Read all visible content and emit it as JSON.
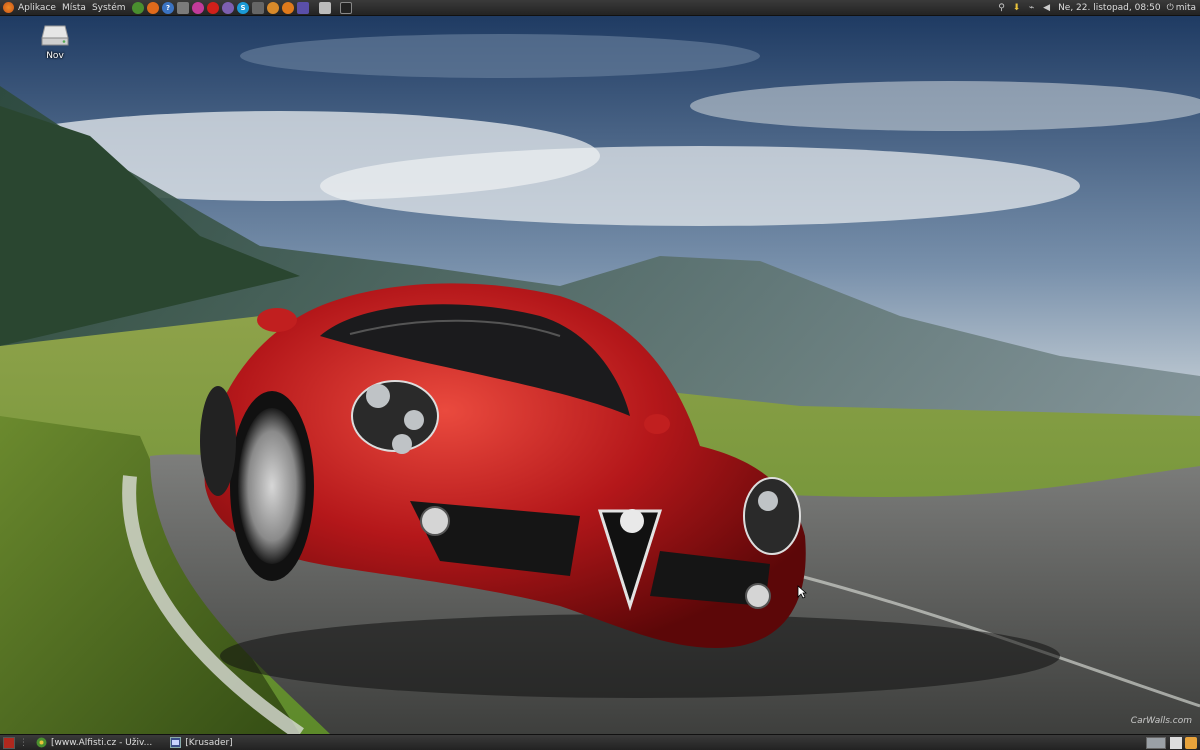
{
  "top_panel": {
    "menus": [
      {
        "label": "Aplikace"
      },
      {
        "label": "Místa"
      },
      {
        "label": "Systém"
      }
    ],
    "launchers": [
      {
        "icon": "chrome-icon",
        "color": "#4a8f2f"
      },
      {
        "icon": "firefox-icon",
        "color": "#e06a1b"
      },
      {
        "icon": "help-icon",
        "color": "#3b73c2"
      },
      {
        "icon": "calculator-icon",
        "color": "#7b7b7b"
      },
      {
        "icon": "picasa-icon",
        "color": "#c23b9a"
      },
      {
        "icon": "opera-icon",
        "color": "#d0201a"
      },
      {
        "icon": "pidgin-icon",
        "color": "#7d5fb0"
      },
      {
        "icon": "skype-icon",
        "color": "#1b9ad6"
      },
      {
        "icon": "network-tool-icon",
        "color": "#666666"
      },
      {
        "icon": "gimp-icon",
        "color": "#d98a2a"
      },
      {
        "icon": "fox-icon",
        "color": "#e07a1b"
      },
      {
        "icon": "video-editor-icon",
        "color": "#5a4fa8"
      },
      {
        "icon": "printer-icon",
        "color": "#bbbbbb"
      },
      {
        "icon": "terminal-icon",
        "color": "#222222"
      }
    ],
    "tray": {
      "icons": [
        "accessibility-icon",
        "download-icon",
        "network-icon",
        "volume-icon"
      ],
      "clock": "Ne, 22. listopad, 08:50",
      "user": "mita"
    }
  },
  "desktop": {
    "icons": [
      {
        "label": "Nov",
        "icon": "drive-icon"
      }
    ],
    "watermark": "CarWalls.com"
  },
  "bottom_panel": {
    "tasks": [
      {
        "label": "[www.Alfisti.cz - Uživ...",
        "icon": "browser-icon"
      },
      {
        "label": "[Krusader]",
        "icon": "krusader-icon"
      }
    ]
  },
  "colors": {
    "car_red": "#b4171a",
    "panel": "#2b2b2b"
  }
}
